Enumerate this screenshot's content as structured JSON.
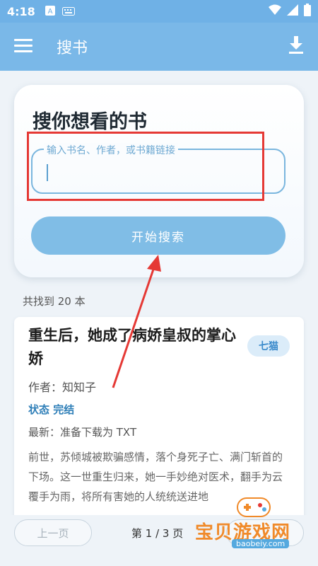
{
  "status_bar": {
    "time": "4:18"
  },
  "app_bar": {
    "title": "搜书"
  },
  "search": {
    "heading": "搜你想看的书",
    "placeholder": "输入书名、作者，或书籍链接",
    "button": "开始搜索"
  },
  "results": {
    "count_text": "共找到 20 本",
    "book": {
      "title": "重生后，她成了病娇皇叔的掌心娇",
      "source_badge": "七猫",
      "author": "作者：知知子",
      "status": "状态 完结",
      "latest": "最新：准备下载为 TXT",
      "description": "前世，苏倾城被欺骗感情，落个身死子亡、满门斩首的下场。这一世重生归来，她一手妙绝对医术，翻手为云覆手为雨，将所有害她的人统统送进地"
    }
  },
  "pager": {
    "prev": "上一页",
    "page": "第 1 / 3 页"
  },
  "watermark": {
    "text": "宝贝游戏网",
    "url": "baobeiy.com"
  },
  "colors": {
    "primary": "#7ab8e8",
    "annotation_red": "#e53935",
    "watermark_orange": "#f08a2a"
  }
}
